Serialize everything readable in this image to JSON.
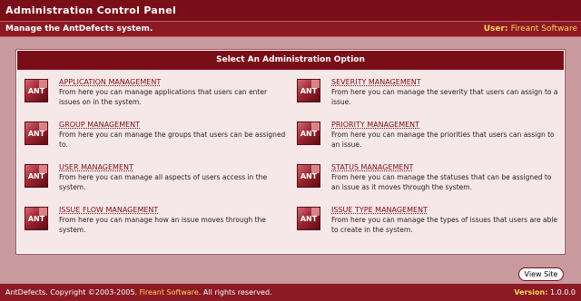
{
  "header": {
    "title": "Administration Control Panel",
    "subtitle": "Manage the AntDefects system.",
    "user_label": "User:",
    "user_name": "Fireant Software"
  },
  "panel": {
    "heading": "Select An Administration Option",
    "logo_text": "ANT",
    "options": [
      {
        "title": "APPLICATION MANAGEMENT",
        "desc": "From here you can manage applications that users can enter issues on in the system."
      },
      {
        "title": "SEVERITY MANAGEMENT",
        "desc": "From here you can manage the severity that users can assign to a issue."
      },
      {
        "title": "GROUP MANAGEMENT",
        "desc": "From here you can manage the groups that users can be assigned to."
      },
      {
        "title": "PRIORITY MANAGEMENT",
        "desc": "From here you can manage the priorities that users can assign to an issue."
      },
      {
        "title": "USER MANAGEMENT",
        "desc": "From here you can manage all aspects of users access in the system."
      },
      {
        "title": "STATUS MANAGEMENT",
        "desc": "From here you can manage the statuses that can be assigned to an issue as it moves through the system."
      },
      {
        "title": "ISSUE FLOW MANAGEMENT",
        "desc": "From here you can manage how an issue moves through the system."
      },
      {
        "title": "ISSUE TYPE MANAGEMENT",
        "desc": "From here you can manage the types of issues that users are able to create in the system."
      }
    ]
  },
  "view_site_label": "View Site",
  "footer": {
    "copyright_prefix": "AntDefects. Copyright ©2003-2005.",
    "company": "Fireant Software",
    "copyright_suffix": ". All rights reserved.",
    "version_label": "Version:",
    "version_value": "1.0.0.0"
  },
  "colors": {
    "brand": "#7a0e18",
    "background": "#c89a9d",
    "accent": "#ffd35a"
  }
}
